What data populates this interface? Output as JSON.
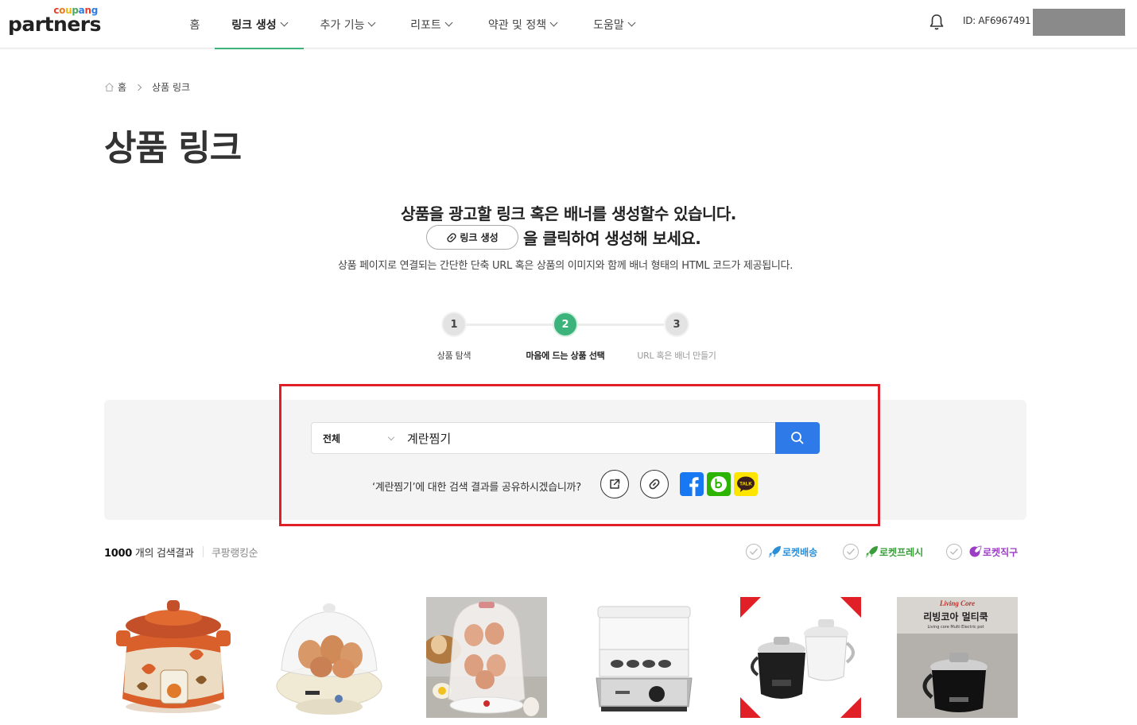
{
  "header": {
    "logo_small": [
      "c",
      "o",
      "u",
      "p",
      "a",
      "n",
      "g"
    ],
    "logo_main": "partners",
    "nav": [
      {
        "label": "홈",
        "dropdown": false,
        "active": false
      },
      {
        "label": "링크 생성",
        "dropdown": true,
        "active": true
      },
      {
        "label": "추가 기능",
        "dropdown": true,
        "active": false
      },
      {
        "label": "리포트",
        "dropdown": true,
        "active": false
      },
      {
        "label": "약관 및 정책",
        "dropdown": true,
        "active": false
      },
      {
        "label": "도움말",
        "dropdown": true,
        "active": false
      }
    ],
    "user_id": "ID: AF6967491",
    "accent": "#3bb37a"
  },
  "breadcrumb": {
    "home": "홈",
    "current": "상품 링크"
  },
  "page_title": "상품 링크",
  "intro": {
    "line1": "상품을 광고할 링크 혹은 배너를 생성할수 있습니다.",
    "button_label": "링크 생성",
    "line2": "을 클릭하여 생성해 보세요.",
    "line3": "상품 페이지로 연결되는 간단한 단축 URL 혹은 상품의 이미지와 함께 배너 형태의 HTML 코드가 제공됩니다."
  },
  "steps": [
    {
      "number": "1",
      "label": "상품 탐색",
      "state": "done"
    },
    {
      "number": "2",
      "label": "마음에 드는 상품 선택",
      "state": "current"
    },
    {
      "number": "3",
      "label": "URL 혹은 배너 만들기",
      "state": "todo"
    }
  ],
  "search": {
    "category": "전체",
    "query": "계란찜기",
    "share_prompt": "‘계란찜기’에 대한 검색 결과를 공유하시겠습니까?",
    "button_color": "#2e7ae8"
  },
  "results": {
    "count": "1000",
    "count_suffix": " 개의 검색결과",
    "sort": "쿠팡랭킹순",
    "filters": [
      {
        "label": "로켓배송",
        "color": "#2a8fd6"
      },
      {
        "label": "로켓프레시",
        "color": "#3a9d3a"
      },
      {
        "label": "로켓직구",
        "color": "#9b3ec5"
      }
    ]
  },
  "products": [
    {
      "image": "clay-pot-cooker"
    },
    {
      "image": "egg-cooker-white"
    },
    {
      "image": "egg-steamer-double"
    },
    {
      "image": "egg-steamer-stainless"
    },
    {
      "image": "electric-pot-two"
    },
    {
      "image": "multi-cooker-livingcore",
      "banner_top": "Living Core",
      "banner_main": "리빙코아 멀티쿡",
      "banner_sub": "Living core Multi Electric pot"
    }
  ]
}
